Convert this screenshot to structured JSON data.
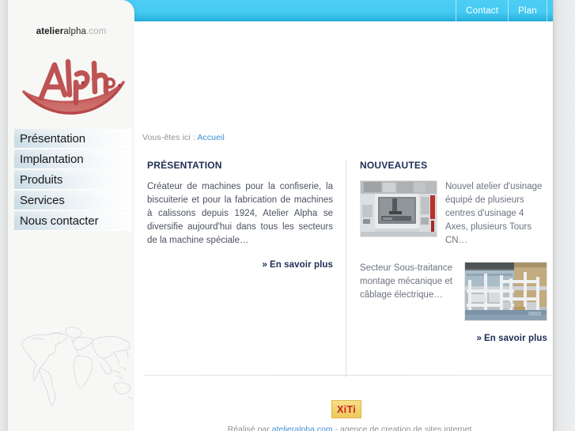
{
  "topbar": {
    "links": [
      {
        "label": "Contact"
      },
      {
        "label": "Plan"
      }
    ],
    "color": "#46cbf3"
  },
  "sidebar": {
    "brand": {
      "part1": "atelier",
      "part2": "alpha",
      "part3": ".com"
    },
    "logo_text": "Alpha",
    "logo_color": "#c0504d",
    "nav": [
      {
        "label": "Présentation"
      },
      {
        "label": "Implantation"
      },
      {
        "label": "Produits"
      },
      {
        "label": "Services"
      },
      {
        "label": "Nous contacter"
      }
    ],
    "watermark": "world-map"
  },
  "breadcrumb": {
    "prefix": "Vous-êtes ici :",
    "current": "Accueil"
  },
  "main": {
    "left": {
      "title": "PRÉSENTATION",
      "body": "Créateur de machines pour la confiserie, la biscuiterie et pour la fabrication de machines à calissons depuis 1924, Atelier Alpha se diversifie aujourd'hui dans tous les secteurs de la machine spéciale…",
      "more_label": "En savoir plus",
      "more_chevron": "»"
    },
    "right": {
      "title": "NOUVEAUTES",
      "items": [
        {
          "text": "Nouvel atelier d'usinage équipé de plusieurs centres d'usinage 4 Axes, plusieurs Tours CN…",
          "image": "cnc-machining-center-photo",
          "image_position": "left"
        },
        {
          "text": "Secteur Sous-traitance montage mécanique et câblage électrique…",
          "image": "workshop-assembly-photo",
          "image_position": "right"
        }
      ],
      "more_label": "En savoir plus",
      "more_chevron": "»"
    }
  },
  "footer": {
    "xiti_label": "XiTi",
    "note_prefix": "Réalisé par ",
    "note_link": "atelieralpha.com",
    "note_suffix": " - agence de creation de sites internet"
  }
}
